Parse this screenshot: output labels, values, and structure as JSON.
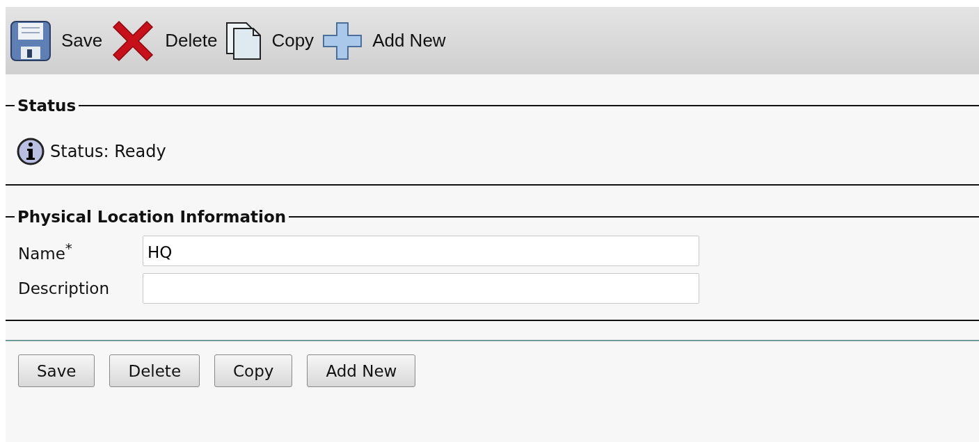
{
  "toolbar": [
    {
      "kind": "save",
      "label": "Save"
    },
    {
      "kind": "delete",
      "label": "Delete"
    },
    {
      "kind": "copy",
      "label": "Copy"
    },
    {
      "kind": "add",
      "label": "Add New"
    }
  ],
  "status_section": {
    "title": "Status",
    "message": "Status: Ready"
  },
  "location_section": {
    "title": "Physical Location Information",
    "fields": [
      {
        "label": "Name",
        "required_mark": "*",
        "value": "HQ"
      },
      {
        "label": "Description"
      }
    ]
  },
  "buttons": [
    "Save",
    "Delete",
    "Copy",
    "Add New"
  ]
}
